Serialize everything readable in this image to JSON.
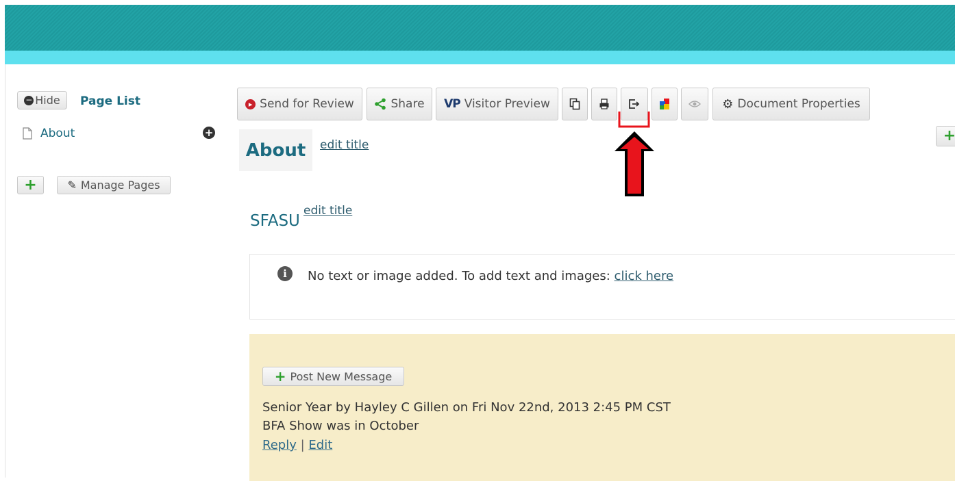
{
  "sidebar": {
    "hide_label": "Hide",
    "page_list_label": "Page List",
    "items": [
      {
        "label": "About"
      }
    ],
    "manage_pages_label": "Manage Pages"
  },
  "toolbar": {
    "send_for_review": "Send for Review",
    "share": "Share",
    "visitor_preview": "Visitor Preview",
    "document_properties": "Document Properties"
  },
  "page": {
    "title": "About",
    "edit_title": "edit title"
  },
  "section": {
    "title": "SFASU",
    "edit_title": "edit title",
    "notice_text": "No text or image added. To add text and images:",
    "notice_link": "click here"
  },
  "messages": {
    "post_label": "Post New Message",
    "items": [
      {
        "header": "Senior Year by Hayley C Gillen on Fri Nov 22nd, 2013 2:45 PM CST",
        "body": "BFA Show was in October",
        "reply": "Reply",
        "separator": "|",
        "edit": "Edit"
      }
    ]
  },
  "colors": {
    "banner": "#22a3a6",
    "banner_strip": "#5ee0ee",
    "accent_text": "#1c6b80",
    "messages_bg": "#f7edc9",
    "highlight": "#e8141c"
  }
}
